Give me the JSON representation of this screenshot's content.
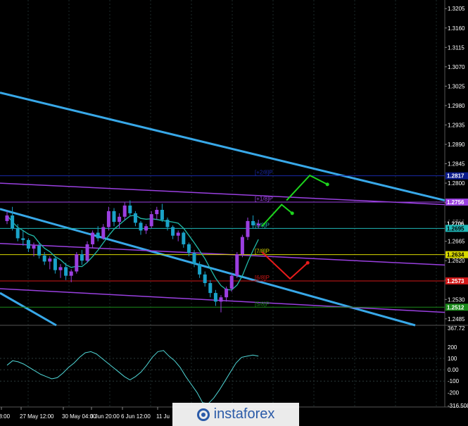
{
  "colors": {
    "background": "#000000",
    "candle_up": "#9b3fe0",
    "candle_down": "#1aa2c8",
    "channel_blue": "#38a8e8",
    "channel_purple": "#9a40e0",
    "ma_line": "#21b9a8",
    "osc_line": "#4fd6d6",
    "arrow_green": "#1dd41d",
    "arrow_red": "#e81b1b",
    "grid": "#1c2a2a"
  },
  "chart_data": {
    "type": "candlestick",
    "instrument_hint": "",
    "price_axis": {
      "ticks": [
        "1.3205",
        "1.3160",
        "1.3115",
        "1.3070",
        "1.3025",
        "1.2980",
        "1.2935",
        "1.2890",
        "1.2845",
        "1.2800",
        "1.2755",
        "1.2710",
        "1.2665",
        "1.2620",
        "1.2575",
        "1.2530",
        "1.2485"
      ],
      "ylim": [
        1.247,
        1.3225
      ]
    },
    "price_tags": [
      {
        "value": "1.2817",
        "price": 1.2817,
        "bg": "#0a1a8c",
        "fg": "#ffffff"
      },
      {
        "value": "1.2756",
        "price": 1.2756,
        "bg": "#9a40e0",
        "fg": "#ffffff"
      },
      {
        "value": "1.2706",
        "price": 1.2706,
        "bg": "#000000",
        "fg": "#ffffff"
      },
      {
        "value": "1.2695",
        "price": 1.2695,
        "bg": "#20b8b8",
        "fg": "#000000"
      },
      {
        "value": "1.2634",
        "price": 1.2634,
        "bg": "#d9d900",
        "fg": "#000000"
      },
      {
        "value": "1.2573",
        "price": 1.2573,
        "bg": "#d01818",
        "fg": "#ffffff"
      },
      {
        "value": "1.2512",
        "price": 1.2512,
        "bg": "#1a8a1a",
        "fg": "#ffffff"
      }
    ],
    "murrey_levels": [
      {
        "label": "[+2/8]P",
        "price": 1.2817,
        "color": "#1a2aa8"
      },
      {
        "label": "[+1/8]P",
        "price": 1.2756,
        "color": "#9a40e0"
      },
      {
        "label": "[8/8]P",
        "price": 1.2695,
        "color": "#20b8b8"
      },
      {
        "label": "[7/8]P",
        "price": 1.2634,
        "color": "#d9d900"
      },
      {
        "label": "[6/8]P",
        "price": 1.2573,
        "color": "#d01818"
      },
      {
        "label": "[5/8]P",
        "price": 1.2512,
        "color": "#1a8a1a"
      }
    ],
    "time_axis": {
      "labels": [
        "28:00",
        "27 May 12:00",
        "30 May 04:00",
        "3 Jun 20:00",
        "6 Jun 12:00",
        "11 Ju"
      ]
    },
    "oscillator": {
      "ticks": [
        "367.72",
        "200",
        "100",
        "0.00",
        "-100",
        "-200",
        "-316.508"
      ],
      "ylim": [
        -316.508,
        367.72
      ],
      "values": [
        40,
        80,
        70,
        50,
        20,
        -10,
        -40,
        -60,
        -80,
        -70,
        -30,
        20,
        60,
        110,
        150,
        160,
        140,
        100,
        60,
        20,
        -20,
        -60,
        -90,
        -60,
        -20,
        40,
        110,
        160,
        170,
        120,
        80,
        20,
        -60,
        -130,
        -200,
        -290,
        -300,
        -250,
        -180,
        -100,
        -20,
        60,
        110,
        120,
        130,
        120
      ]
    },
    "candles": [
      {
        "o": 1.2712,
        "h": 1.2735,
        "l": 1.2705,
        "c": 1.2725
      },
      {
        "o": 1.2725,
        "h": 1.2745,
        "l": 1.269,
        "c": 1.2695
      },
      {
        "o": 1.2695,
        "h": 1.2705,
        "l": 1.2665,
        "c": 1.2672
      },
      {
        "o": 1.2672,
        "h": 1.269,
        "l": 1.2655,
        "c": 1.2668
      },
      {
        "o": 1.2668,
        "h": 1.2672,
        "l": 1.264,
        "c": 1.2648
      },
      {
        "o": 1.2648,
        "h": 1.2662,
        "l": 1.263,
        "c": 1.2655
      },
      {
        "o": 1.2655,
        "h": 1.266,
        "l": 1.2625,
        "c": 1.2632
      },
      {
        "o": 1.2632,
        "h": 1.264,
        "l": 1.261,
        "c": 1.2618
      },
      {
        "o": 1.2618,
        "h": 1.263,
        "l": 1.26,
        "c": 1.2625
      },
      {
        "o": 1.2625,
        "h": 1.2628,
        "l": 1.259,
        "c": 1.2598
      },
      {
        "o": 1.2598,
        "h": 1.2612,
        "l": 1.258,
        "c": 1.2605
      },
      {
        "o": 1.2605,
        "h": 1.2615,
        "l": 1.2575,
        "c": 1.2585
      },
      {
        "o": 1.2585,
        "h": 1.26,
        "l": 1.257,
        "c": 1.2595
      },
      {
        "o": 1.2595,
        "h": 1.264,
        "l": 1.259,
        "c": 1.2635
      },
      {
        "o": 1.2635,
        "h": 1.2645,
        "l": 1.261,
        "c": 1.262
      },
      {
        "o": 1.262,
        "h": 1.2665,
        "l": 1.2615,
        "c": 1.2658
      },
      {
        "o": 1.2658,
        "h": 1.269,
        "l": 1.265,
        "c": 1.2685
      },
      {
        "o": 1.2685,
        "h": 1.27,
        "l": 1.2665,
        "c": 1.2672
      },
      {
        "o": 1.2672,
        "h": 1.2705,
        "l": 1.2668,
        "c": 1.2698
      },
      {
        "o": 1.2698,
        "h": 1.2745,
        "l": 1.269,
        "c": 1.2735
      },
      {
        "o": 1.2735,
        "h": 1.2742,
        "l": 1.27,
        "c": 1.271
      },
      {
        "o": 1.271,
        "h": 1.273,
        "l": 1.2695,
        "c": 1.2722
      },
      {
        "o": 1.2722,
        "h": 1.2755,
        "l": 1.2715,
        "c": 1.2748
      },
      {
        "o": 1.2748,
        "h": 1.276,
        "l": 1.2725,
        "c": 1.273
      },
      {
        "o": 1.273,
        "h": 1.2735,
        "l": 1.27,
        "c": 1.2708
      },
      {
        "o": 1.2708,
        "h": 1.2712,
        "l": 1.268,
        "c": 1.269
      },
      {
        "o": 1.269,
        "h": 1.2705,
        "l": 1.2682,
        "c": 1.27
      },
      {
        "o": 1.27,
        "h": 1.2735,
        "l": 1.2695,
        "c": 1.2728
      },
      {
        "o": 1.2728,
        "h": 1.2745,
        "l": 1.2715,
        "c": 1.2738
      },
      {
        "o": 1.2738,
        "h": 1.2752,
        "l": 1.271,
        "c": 1.2715
      },
      {
        "o": 1.2715,
        "h": 1.272,
        "l": 1.269,
        "c": 1.2698
      },
      {
        "o": 1.2698,
        "h": 1.2702,
        "l": 1.267,
        "c": 1.2678
      },
      {
        "o": 1.2678,
        "h": 1.269,
        "l": 1.2665,
        "c": 1.2685
      },
      {
        "o": 1.2685,
        "h": 1.2688,
        "l": 1.265,
        "c": 1.2658
      },
      {
        "o": 1.2658,
        "h": 1.2662,
        "l": 1.263,
        "c": 1.2638
      },
      {
        "o": 1.2638,
        "h": 1.2645,
        "l": 1.2605,
        "c": 1.2612
      },
      {
        "o": 1.2612,
        "h": 1.2618,
        "l": 1.258,
        "c": 1.2588
      },
      {
        "o": 1.2588,
        "h": 1.2595,
        "l": 1.256,
        "c": 1.2568
      },
      {
        "o": 1.2568,
        "h": 1.2575,
        "l": 1.2535,
        "c": 1.2545
      },
      {
        "o": 1.2545,
        "h": 1.2552,
        "l": 1.2515,
        "c": 1.2525
      },
      {
        "o": 1.2525,
        "h": 1.254,
        "l": 1.25,
        "c": 1.2535
      },
      {
        "o": 1.2535,
        "h": 1.256,
        "l": 1.2525,
        "c": 1.2555
      },
      {
        "o": 1.2555,
        "h": 1.259,
        "l": 1.2548,
        "c": 1.2585
      },
      {
        "o": 1.2585,
        "h": 1.264,
        "l": 1.258,
        "c": 1.2635
      },
      {
        "o": 1.2635,
        "h": 1.268,
        "l": 1.2628,
        "c": 1.2675
      },
      {
        "o": 1.2675,
        "h": 1.272,
        "l": 1.2668,
        "c": 1.2712
      },
      {
        "o": 1.2712,
        "h": 1.2725,
        "l": 1.2695,
        "c": 1.2702
      },
      {
        "o": 1.2702,
        "h": 1.2715,
        "l": 1.2695,
        "c": 1.2706
      }
    ]
  },
  "brand": {
    "name": "instaforex"
  }
}
